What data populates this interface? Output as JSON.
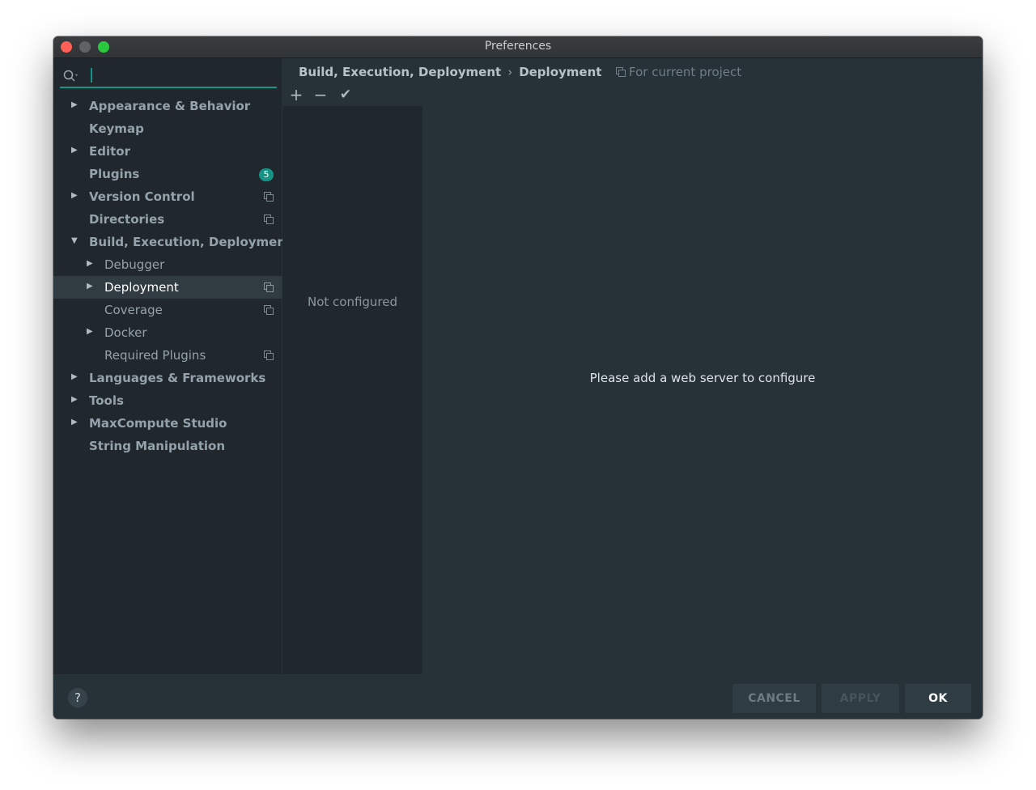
{
  "window": {
    "title": "Preferences"
  },
  "search": {
    "value": "",
    "placeholder": ""
  },
  "sidebar": {
    "items": [
      {
        "label": "Appearance & Behavior"
      },
      {
        "label": "Keymap"
      },
      {
        "label": "Editor"
      },
      {
        "label": "Plugins",
        "badge": "5"
      },
      {
        "label": "Version Control"
      },
      {
        "label": "Directories"
      },
      {
        "label": "Build, Execution, Deployment"
      },
      {
        "label": "Debugger"
      },
      {
        "label": "Deployment"
      },
      {
        "label": "Coverage"
      },
      {
        "label": "Docker"
      },
      {
        "label": "Required Plugins"
      },
      {
        "label": "Languages & Frameworks"
      },
      {
        "label": "Tools"
      },
      {
        "label": "MaxCompute Studio"
      },
      {
        "label": "String Manipulation"
      }
    ]
  },
  "breadcrumb": {
    "parent": "Build, Execution, Deployment",
    "separator": "›",
    "current": "Deployment"
  },
  "scope": {
    "label": "For current project"
  },
  "toolbar": {
    "add": "+",
    "remove": "−",
    "apply": "✔"
  },
  "servers": {
    "empty_text": "Not configured"
  },
  "details": {
    "message": "Please add a web server to configure"
  },
  "footer": {
    "help": "?",
    "cancel": "CANCEL",
    "apply": "APPLY",
    "ok": "OK"
  },
  "colors": {
    "accent": "#16958a",
    "window_bg": "#263238",
    "sidebar_bg": "#21282d",
    "selected_bg": "#313b42",
    "close": "#fe5f57",
    "maximize": "#2ac940"
  }
}
